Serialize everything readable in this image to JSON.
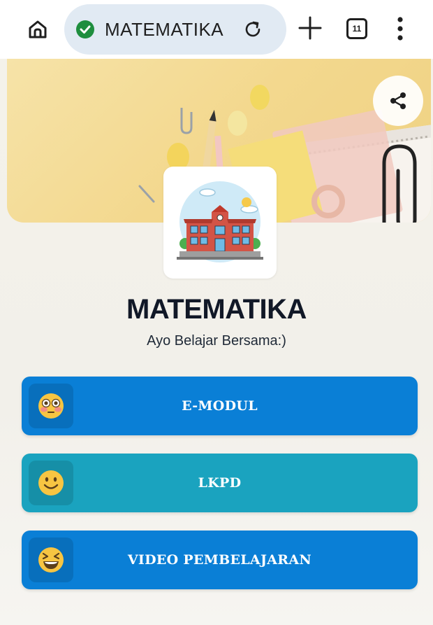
{
  "browser": {
    "omnibox_title": "MATEMATIKA",
    "tab_count": "11"
  },
  "profile": {
    "title": "MATEMATIKA",
    "subtitle": "Ayo Belajar Bersama:)"
  },
  "links": [
    {
      "label": "E-MODUL",
      "icon": "flushed-face-emoji",
      "color": "#0a7fd6"
    },
    {
      "label": "LKPD",
      "icon": "smiling-face-emoji",
      "color": "#1aa3bf"
    },
    {
      "label": "VIDEO PEMBELAJARAN",
      "icon": "grinning-squinting-face-emoji",
      "color": "#0a7fd6"
    }
  ],
  "colors": {
    "primary_button": "#0a7fd6",
    "secondary_button": "#1aa3bf",
    "secure_badge": "#1e8e3e",
    "omnibox_bg": "#e1eaf3"
  }
}
